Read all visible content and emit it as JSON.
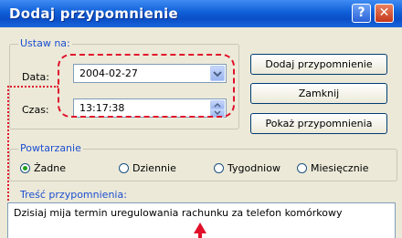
{
  "window": {
    "title": "Dodaj przypomnienie",
    "help_glyph": "?",
    "close_glyph": "✕"
  },
  "ustaw": {
    "legend": "Ustaw na:",
    "date_label": "Data:",
    "date_value": "2004-02-27",
    "time_label": "Czas:",
    "time_value": "13:17:38"
  },
  "buttons": {
    "add": "Dodaj przypomnienie",
    "close": "Zamknij",
    "show": "Pokaż przypomnienia"
  },
  "repeat": {
    "legend": "Powtarzanie",
    "options": [
      {
        "label": "Żadne",
        "selected": true
      },
      {
        "label": "Dziennie",
        "selected": false
      },
      {
        "label": "Tygodniow",
        "selected": false
      },
      {
        "label": "Miesięcznie",
        "selected": false
      }
    ]
  },
  "content": {
    "legend": "Treść przypomnienia:",
    "text": "Dzisiaj mija termin uregulowania rachunku za telefon komórkowy"
  },
  "colors": {
    "annotation_red": "#e0102a",
    "legend_blue": "#1c4fd1",
    "titlebar_blue": "#0a4fc7"
  }
}
